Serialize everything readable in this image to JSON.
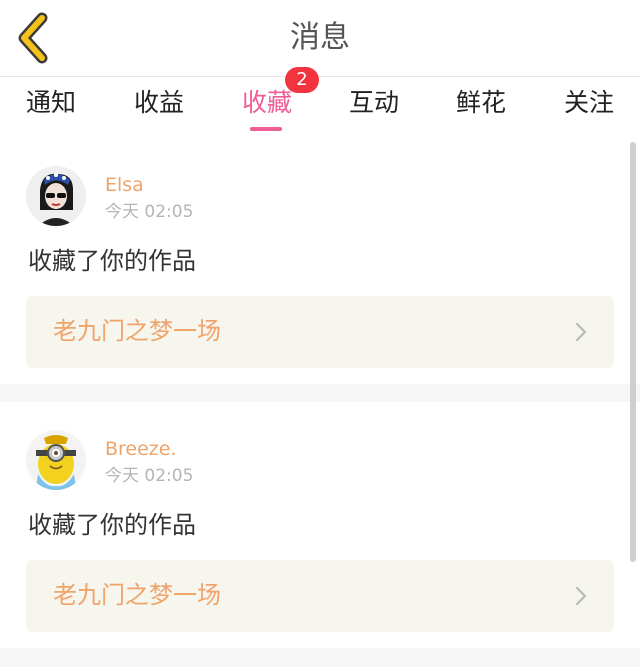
{
  "header": {
    "title": "消息"
  },
  "tabs": [
    {
      "label": "通知"
    },
    {
      "label": "收益"
    },
    {
      "label": "收藏"
    },
    {
      "label": "互动"
    },
    {
      "label": "鲜花"
    },
    {
      "label": "关注"
    }
  ],
  "active_tab_badge": "2",
  "colors": {
    "accent": "#ee5e95",
    "username": "#f0a46a",
    "badge": "#f2343f",
    "back_icon": "#f3c21b"
  },
  "items": [
    {
      "username": "Elsa",
      "time": "今天 02:05",
      "action": "收藏了你的作品",
      "work_title": "老九门之梦一场"
    },
    {
      "username": "Breeze.",
      "time": "今天 02:05",
      "action": "收藏了你的作品",
      "work_title": "老九门之梦一场"
    }
  ]
}
